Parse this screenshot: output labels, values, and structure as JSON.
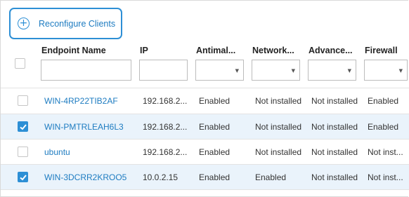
{
  "toolbar": {
    "reconfigure_label": "Reconfigure Clients",
    "reconfigure_icon": "plus-circle-icon"
  },
  "accent": "#2d8fd5",
  "columns": [
    {
      "key": "name",
      "label": "Endpoint Name",
      "filter": "text"
    },
    {
      "key": "ip",
      "label": "IP",
      "filter": "text"
    },
    {
      "key": "antimalware",
      "label": "Antimal...",
      "filter": "select"
    },
    {
      "key": "network",
      "label": "Network...",
      "filter": "select"
    },
    {
      "key": "advanced",
      "label": "Advance...",
      "filter": "select"
    },
    {
      "key": "firewall",
      "label": "Firewall",
      "filter": "select"
    }
  ],
  "rows": [
    {
      "checked": false,
      "name": "WIN-4RP22TIB2AF",
      "ip": "192.168.2...",
      "antimalware": "Enabled",
      "network": "Not installed",
      "advanced": "Not installed",
      "firewall": "Enabled"
    },
    {
      "checked": true,
      "name": "WIN-PMTRLEAH6L3",
      "ip": "192.168.2...",
      "antimalware": "Enabled",
      "network": "Not installed",
      "advanced": "Not installed",
      "firewall": "Enabled"
    },
    {
      "checked": false,
      "name": "ubuntu",
      "ip": "192.168.2...",
      "antimalware": "Enabled",
      "network": "Not installed",
      "advanced": "Not installed",
      "firewall": "Not inst..."
    },
    {
      "checked": true,
      "name": "WIN-3DCRR2KROO5",
      "ip": "10.0.2.15",
      "antimalware": "Enabled",
      "network": "Enabled",
      "advanced": "Not installed",
      "firewall": "Not inst..."
    }
  ]
}
